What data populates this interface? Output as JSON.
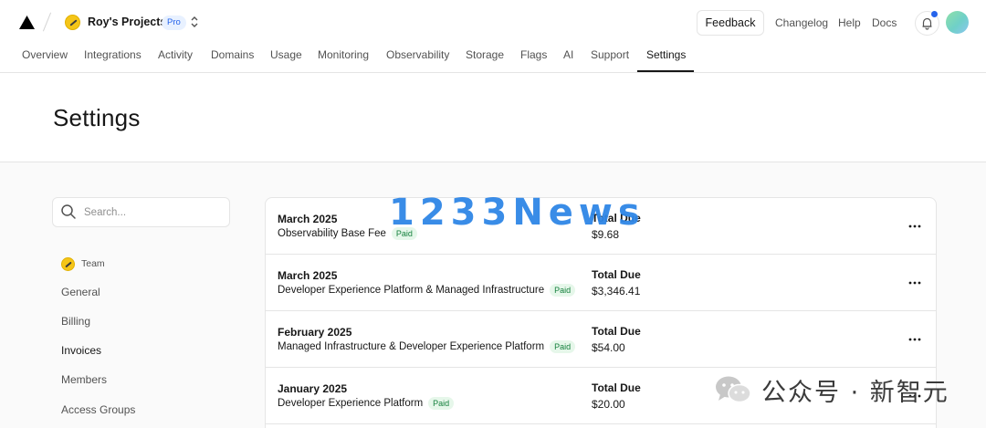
{
  "header": {
    "project_name": "Roy's Projects",
    "plan_badge": "Pro",
    "feedback_label": "Feedback",
    "links": [
      "Changelog",
      "Help",
      "Docs"
    ]
  },
  "tabs": [
    "Overview",
    "Integrations",
    "Activity",
    "Domains",
    "Usage",
    "Monitoring",
    "Observability",
    "Storage",
    "Flags",
    "AI",
    "Support",
    "Settings"
  ],
  "active_tab": "Settings",
  "page_title": "Settings",
  "sidebar": {
    "search_placeholder": "Search...",
    "team_label": "Team",
    "items": [
      "General",
      "Billing",
      "Invoices",
      "Members",
      "Access Groups"
    ],
    "active_item": "Invoices"
  },
  "invoices": {
    "total_due_label": "Total Due",
    "rows": [
      {
        "month": "March 2025",
        "description": "Observability Base Fee",
        "status": "Paid",
        "amount": "$9.68"
      },
      {
        "month": "March 2025",
        "description": "Developer Experience Platform & Managed Infrastructure",
        "status": "Paid",
        "amount": "$3,346.41"
      },
      {
        "month": "February 2025",
        "description": "Managed Infrastructure & Developer Experience Platform",
        "status": "Paid",
        "amount": "$54.00"
      },
      {
        "month": "January 2025",
        "description": "Developer Experience Platform",
        "status": "Paid",
        "amount": "$20.00"
      }
    ]
  },
  "watermarks": {
    "news": "1233News",
    "cn": "公众号 · 新智元"
  },
  "colors": {
    "accent": "#2563eb",
    "paid_bg": "#e6f7ea",
    "paid_text": "#15803d",
    "watermark_blue": "#2f86e6"
  }
}
